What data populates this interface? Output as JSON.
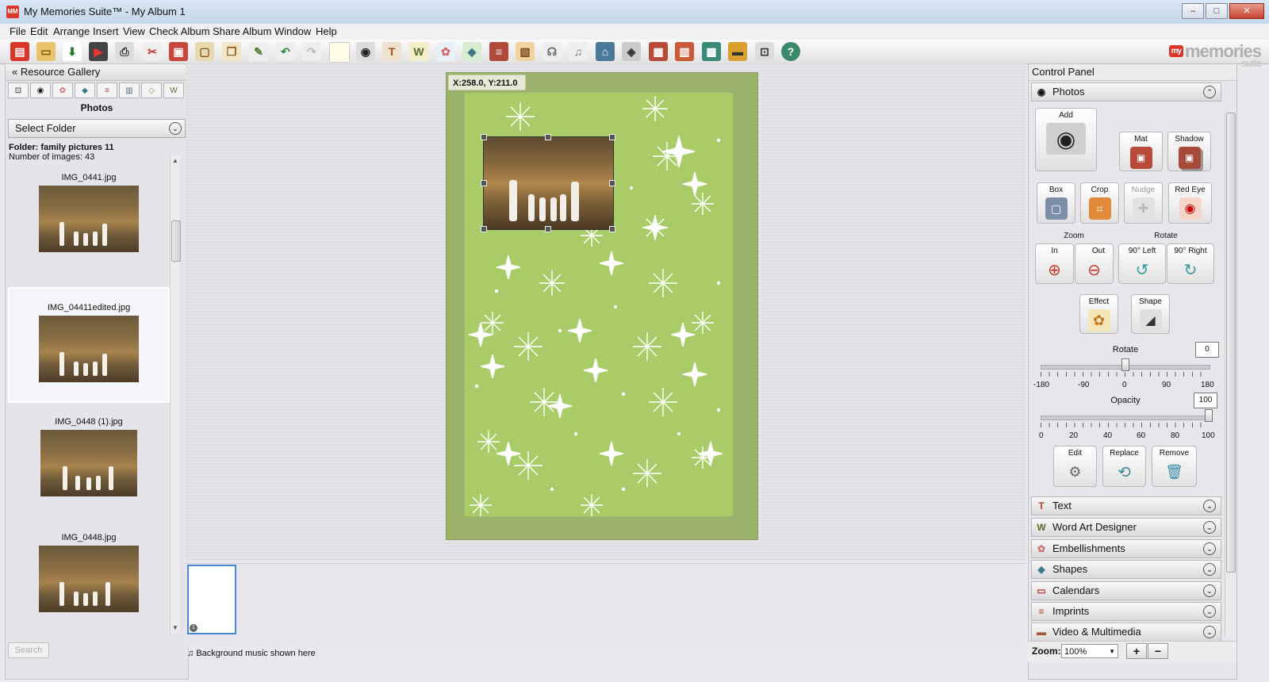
{
  "window": {
    "title": "My Memories Suite™ - My Album 1"
  },
  "menu": [
    "File",
    "Edit",
    "Arrange",
    "Insert",
    "View",
    "Check Album",
    "Share Album",
    "Window",
    "Help"
  ],
  "toolbar": {
    "tools": [
      "new-album",
      "open",
      "save",
      "preview",
      "print",
      "cut",
      "paste",
      "clipboard",
      "copy",
      "tools",
      "undo",
      "redo",
      "new-page",
      "camera",
      "text",
      "word-art",
      "embellishment",
      "shapes",
      "imprints",
      "paper",
      "audio",
      "music",
      "home",
      "frame",
      "layers",
      "arrange",
      "grid",
      "film",
      "cart",
      "help"
    ]
  },
  "logo": {
    "my": "my",
    "brand": "memories",
    "suite": "suite"
  },
  "left_panel": {
    "header": "Resource Gallery",
    "collapse_glyph": "«",
    "section_title": "Photos",
    "select_folder": "Select Folder",
    "folder_label": "Folder: family pictures 11",
    "count_label": "Number of images: 43",
    "images": [
      {
        "name": "IMG_0441.jpg",
        "selected": false
      },
      {
        "name": "IMG_04411edited.jpg",
        "selected": true
      },
      {
        "name": "IMG_0448 (1).jpg",
        "selected": false
      },
      {
        "name": "IMG_0448.jpg",
        "selected": false
      }
    ],
    "search_label": "Search"
  },
  "canvas": {
    "coords": "X:258.0, Y:211.0",
    "page_number": "1",
    "music_label": "Background music shown here",
    "colors": {
      "page_border": "#9bb26a",
      "page_fill": "#a9cc68"
    }
  },
  "control_panel": {
    "title": "Control Panel",
    "photos_section": "Photos",
    "buttons": {
      "add": "Add",
      "mat": "Mat",
      "shadow": "Shadow",
      "box": "Box",
      "crop": "Crop",
      "nudge": "Nudge",
      "red_eye": "Red Eye",
      "zoom_label": "Zoom",
      "rotate_label": "Rotate",
      "zoom_in": "In",
      "zoom_out": "Out",
      "rot_left": "90° Left",
      "rot_right": "90° Right",
      "effect": "Effect",
      "shape": "Shape",
      "edit": "Edit",
      "replace": "Replace",
      "remove": "Remove"
    },
    "rotate": {
      "label": "Rotate",
      "value": "0",
      "ticks": [
        "-180",
        "-90",
        "0",
        "90",
        "180"
      ]
    },
    "opacity": {
      "label": "Opacity",
      "value": "100",
      "ticks": [
        "0",
        "20",
        "40",
        "60",
        "80",
        "100"
      ]
    },
    "sections": [
      "Text",
      "Word Art Designer",
      "Embellishments",
      "Shapes",
      "Calendars",
      "Imprints",
      "Video & Multimedia"
    ],
    "zoom": {
      "label": "Zoom:",
      "value": "100%",
      "plus": "+",
      "minus": "−"
    }
  }
}
